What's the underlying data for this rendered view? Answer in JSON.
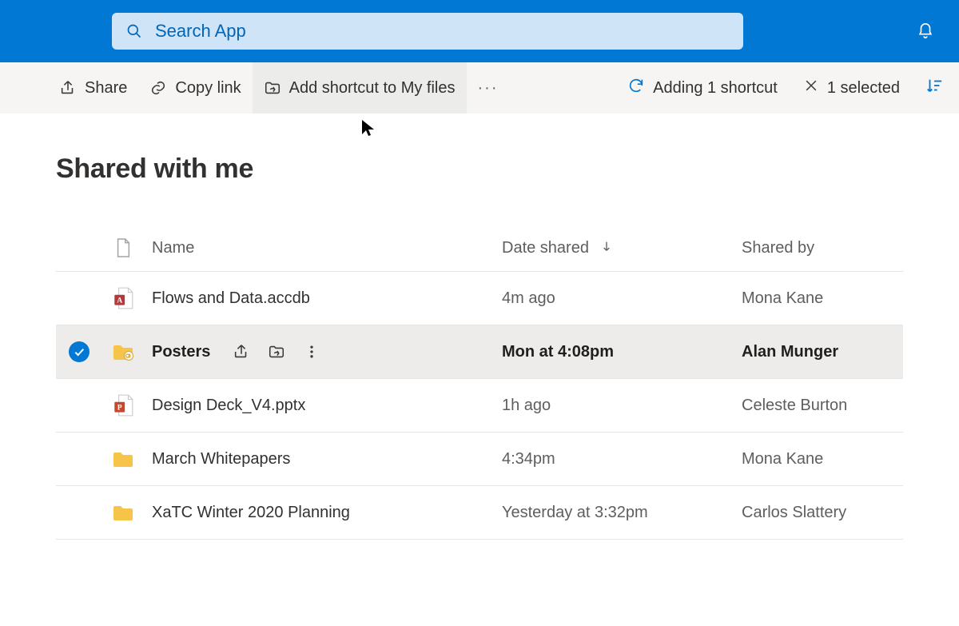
{
  "header": {
    "search_placeholder": "Search App"
  },
  "commandbar": {
    "share": "Share",
    "copy_link": "Copy link",
    "add_shortcut": "Add shortcut to My files",
    "overflow": "···",
    "status_adding": "Adding 1 shortcut",
    "status_selected": "1 selected"
  },
  "page": {
    "title": "Shared with me"
  },
  "columns": {
    "name": "Name",
    "date_shared": "Date shared",
    "shared_by": "Shared by"
  },
  "rows": [
    {
      "icon": "access",
      "name": "Flows and Data.accdb",
      "date": "4m ago",
      "by": "Mona Kane",
      "selected": false
    },
    {
      "icon": "folder-p",
      "name": "Posters",
      "date": "Mon at 4:08pm",
      "by": "Alan Munger",
      "selected": true
    },
    {
      "icon": "ppt",
      "name": "Design Deck_V4.pptx",
      "date": "1h ago",
      "by": "Celeste Burton",
      "selected": false
    },
    {
      "icon": "folder",
      "name": "March Whitepapers",
      "date": "4:34pm",
      "by": "Mona Kane",
      "selected": false
    },
    {
      "icon": "folder",
      "name": "XaTC Winter 2020 Planning",
      "date": "Yesterday at 3:32pm",
      "by": "Carlos Slattery",
      "selected": false
    }
  ]
}
